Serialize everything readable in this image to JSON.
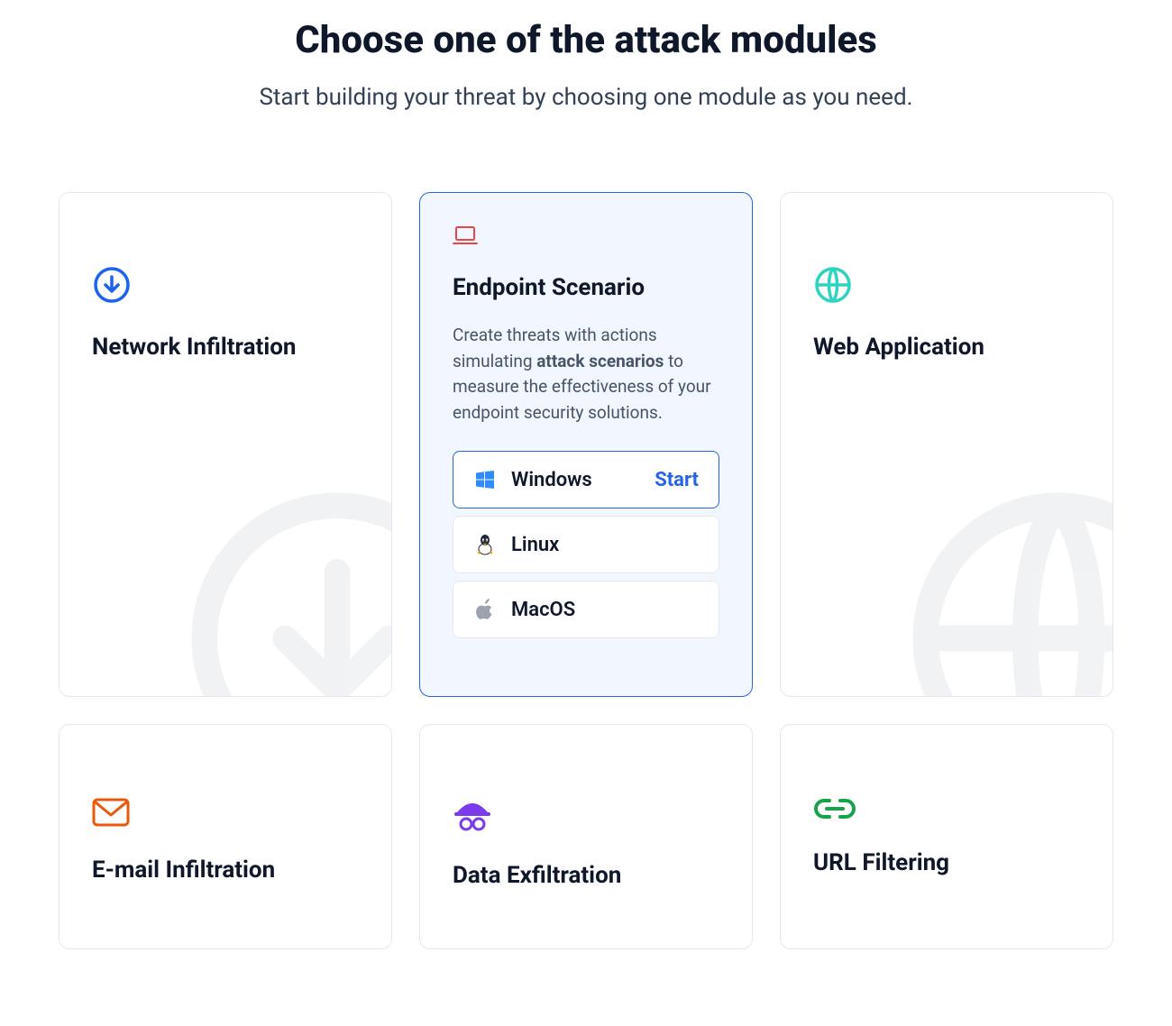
{
  "header": {
    "title": "Choose one of the attack modules",
    "subtitle": "Start building your threat by choosing one module as you need."
  },
  "modules": [
    {
      "id": "network-infiltration",
      "title": "Network Infiltration",
      "icon": "download-circle-icon",
      "color": "#1d62ed",
      "selected": false
    },
    {
      "id": "endpoint-scenario",
      "title": "Endpoint Scenario",
      "icon": "laptop-icon",
      "color": "#ef4444",
      "selected": true,
      "desc_pre": "Create threats with actions simulating ",
      "desc_bold": "attack scenarios",
      "desc_post": " to measure the effectiveness of your endpoint security solutions.",
      "options": [
        {
          "label": "Windows",
          "icon": "windows-icon",
          "active": true,
          "action": "Start"
        },
        {
          "label": "Linux",
          "icon": "linux-icon",
          "active": false
        },
        {
          "label": "MacOS",
          "icon": "apple-icon",
          "active": false
        }
      ]
    },
    {
      "id": "web-application",
      "title": "Web Application",
      "icon": "globe-icon",
      "color": "#2dd4bf",
      "selected": false
    },
    {
      "id": "email-infiltration",
      "title": "E-mail Infiltration",
      "icon": "mail-icon",
      "color": "#ea580c",
      "selected": false
    },
    {
      "id": "data-exfiltration",
      "title": "Data Exfiltration",
      "icon": "spy-icon",
      "color": "#7c3aed",
      "selected": false
    },
    {
      "id": "url-filtering",
      "title": "URL Filtering",
      "icon": "link-icon",
      "color": "#16a34a",
      "selected": false
    }
  ]
}
